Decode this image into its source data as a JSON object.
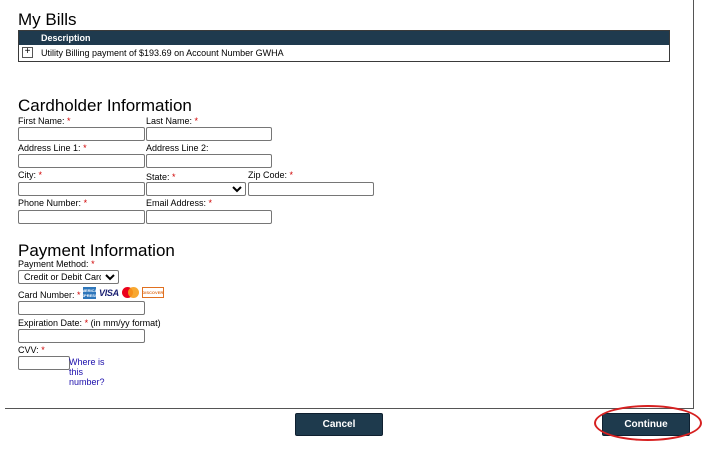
{
  "bills": {
    "title": "My Bills",
    "header": "Description",
    "row": "Utility Billing payment of $193.69 on Account Number GWHA",
    "expand_glyph": "+"
  },
  "cardholder": {
    "title": "Cardholder Information",
    "first_name": "First Name:",
    "last_name": "Last Name:",
    "address1": "Address Line 1:",
    "address2": "Address Line 2:",
    "city": "City:",
    "state": "State:",
    "zip": "Zip Code:",
    "phone": "Phone Number:",
    "email": "Email Address:"
  },
  "payment": {
    "title": "Payment Information",
    "method_label": "Payment Method:",
    "method_value": "Credit or Debit Card",
    "card_number": "Card Number:",
    "card_icons": [
      "amex-icon",
      "visa-icon",
      "mastercard-icon",
      "discover-icon"
    ],
    "amex_text": "AMERICAN EXPRESS",
    "visa_text": "VISA",
    "discover_text": "DISCOVER",
    "expiration": "Expiration Date:",
    "expiration_hint": "(in mm/yy format)",
    "cvv": "CVV:",
    "cvv_help": "Where is this number?"
  },
  "required_mark": "*",
  "buttons": {
    "cancel": "Cancel",
    "continue": "Continue"
  },
  "colors": {
    "header_bg": "#1f3a4e",
    "button_bg": "#1e3a4d",
    "required": "#d00000",
    "highlight_ring": "#d62020",
    "link": "#1a0dab"
  }
}
